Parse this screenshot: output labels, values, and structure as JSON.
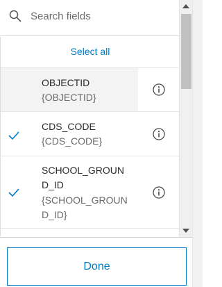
{
  "search": {
    "placeholder": "Search fields",
    "value": ""
  },
  "select_all_label": "Select all",
  "fields": [
    {
      "name": "OBJECTID",
      "alias": "{OBJECTID}",
      "checked": false,
      "info_icon": "info-icon"
    },
    {
      "name": "CDS_CODE",
      "alias": "{CDS_CODE}",
      "checked": true,
      "info_icon": "info-icon"
    },
    {
      "name": "SCHOOL_GROUND_ID",
      "alias": "{SCHOOL_GROUND_ID}",
      "checked": true,
      "info_icon": "info-icon"
    }
  ],
  "done_label": "Done",
  "colors": {
    "accent": "#007ac2",
    "inactive_row": "#f3f3f3",
    "text": "#323232",
    "muted_text": "#6a6a6a"
  },
  "icons": {
    "search": "search-icon",
    "check": "check-icon",
    "info": "info-icon"
  }
}
